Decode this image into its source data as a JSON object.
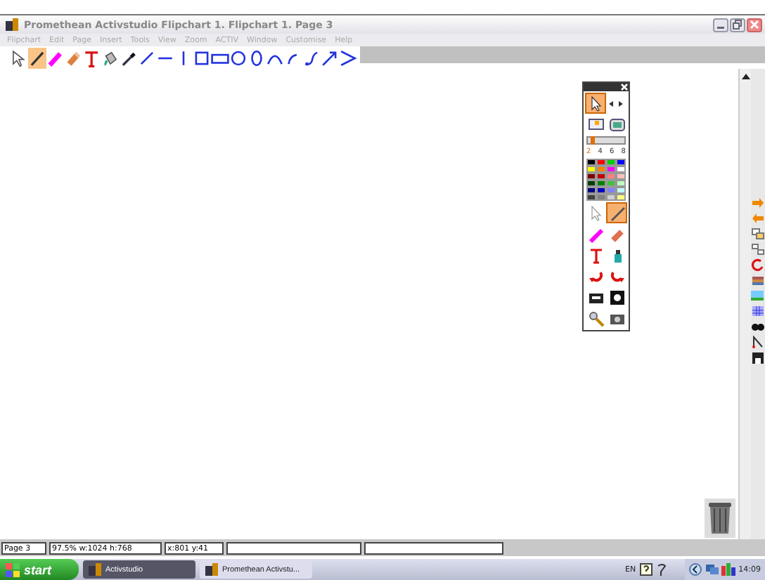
{
  "window": {
    "title": "Promethean Activstudio   Flipchart 1.  Flipchart 1.  Page 3"
  },
  "menu": [
    "Flipchart",
    "Edit",
    "Page",
    "Insert",
    "Tools",
    "View",
    "Zoom",
    "ACTIV",
    "Window",
    "Customise",
    "Help"
  ],
  "tools": [
    {
      "kind": "select",
      "selected": false
    },
    {
      "kind": "pen",
      "selected": true
    },
    {
      "kind": "highlighter",
      "selected": false
    },
    {
      "kind": "eraser",
      "selected": false
    },
    {
      "kind": "text",
      "selected": false
    },
    {
      "kind": "fill",
      "selected": false
    },
    {
      "kind": "dropper",
      "selected": false
    },
    {
      "kind": "diagonal",
      "selected": false
    },
    {
      "kind": "horizontal",
      "selected": false
    },
    {
      "kind": "vertical",
      "selected": false
    },
    {
      "kind": "square",
      "selected": false
    },
    {
      "kind": "rectangle",
      "selected": false
    },
    {
      "kind": "circle",
      "selected": false
    },
    {
      "kind": "ellipse",
      "selected": false
    },
    {
      "kind": "arc",
      "selected": false
    },
    {
      "kind": "smallarc",
      "selected": false
    },
    {
      "kind": "curve",
      "selected": false
    },
    {
      "kind": "arrow",
      "selected": false
    },
    {
      "kind": "chevron",
      "selected": false
    }
  ],
  "toolbox": {
    "widths": [
      {
        "label": "2",
        "selected": true
      },
      {
        "label": "4",
        "selected": false
      },
      {
        "label": "6",
        "selected": false
      },
      {
        "label": "8",
        "selected": false
      }
    ],
    "level": 0.08,
    "colors": [
      {
        "color": "#000000"
      },
      {
        "color": "#ff0000"
      },
      {
        "color": "#00cc00"
      },
      {
        "color": "#0000ff"
      },
      {
        "color": "#ffff00"
      },
      {
        "color": "#ff8000"
      },
      {
        "color": "#ff00ff"
      },
      {
        "color": "#ffffff"
      },
      {
        "color": "#800000"
      },
      {
        "color": "#c00000"
      },
      {
        "color": "#ff8080"
      },
      {
        "color": "#ffc0c0"
      },
      {
        "color": "#004000"
      },
      {
        "color": "#008000"
      },
      {
        "color": "#40c040"
      },
      {
        "color": "#c0ffc0"
      },
      {
        "color": "#000080"
      },
      {
        "color": "#0000c0"
      },
      {
        "color": "#8080ff"
      },
      {
        "color": "#c0ffff"
      },
      {
        "color": "#404040"
      },
      {
        "color": "#808080"
      },
      {
        "color": "#d0d0d0"
      },
      {
        "color": "#ffff80"
      }
    ]
  },
  "status_bar": [
    "Page 3",
    "97.5%  w:1024  h:768",
    "x:801  y:41"
  ],
  "taskbar": {
    "start": "start",
    "tasks": [
      {
        "label": "Activstudio",
        "selected": true
      },
      {
        "label": "Promethean Activstu...",
        "selected": false
      }
    ],
    "language": "EN",
    "clock": "14:09"
  }
}
